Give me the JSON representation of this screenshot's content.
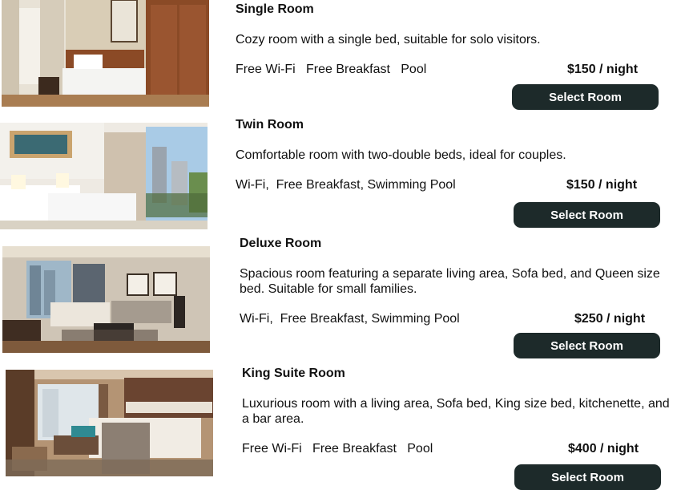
{
  "rooms": [
    {
      "name": "Single Room",
      "description": "Cozy room with a single bed, suitable for solo visitors.",
      "amenities": "Free Wi-Fi   Free Breakfast   Pool",
      "price": "$150 / night",
      "button_label": "Select Room",
      "photo_icon": "single-room-photo"
    },
    {
      "name": "Twin Room",
      "description": "Comfortable room with two-double beds, ideal for couples.",
      "amenities": "Wi-Fi,  Free Breakfast, Swimming Pool",
      "price": "$150 / night",
      "button_label": "Select Room",
      "photo_icon": "twin-room-photo"
    },
    {
      "name": "Deluxe Room",
      "description": "Spacious room featuring a separate living area, Sofa bed, and Queen size bed. Suitable for small families.",
      "amenities": "Wi-Fi,  Free Breakfast, Swimming Pool",
      "price": "$250 / night",
      "button_label": "Select Room",
      "photo_icon": "deluxe-room-photo"
    },
    {
      "name": "King Suite Room",
      "description": "Luxurious room with a living area, Sofa bed, King size bed, kitchenette, and a bar area.",
      "amenities": "Free Wi-Fi   Free Breakfast   Pool",
      "price": "$400 / night",
      "button_label": "Select Room",
      "photo_icon": "king-suite-photo"
    }
  ],
  "colors": {
    "button_bg": "#1d2a2a",
    "button_text": "#ffffff",
    "text": "#111111"
  }
}
